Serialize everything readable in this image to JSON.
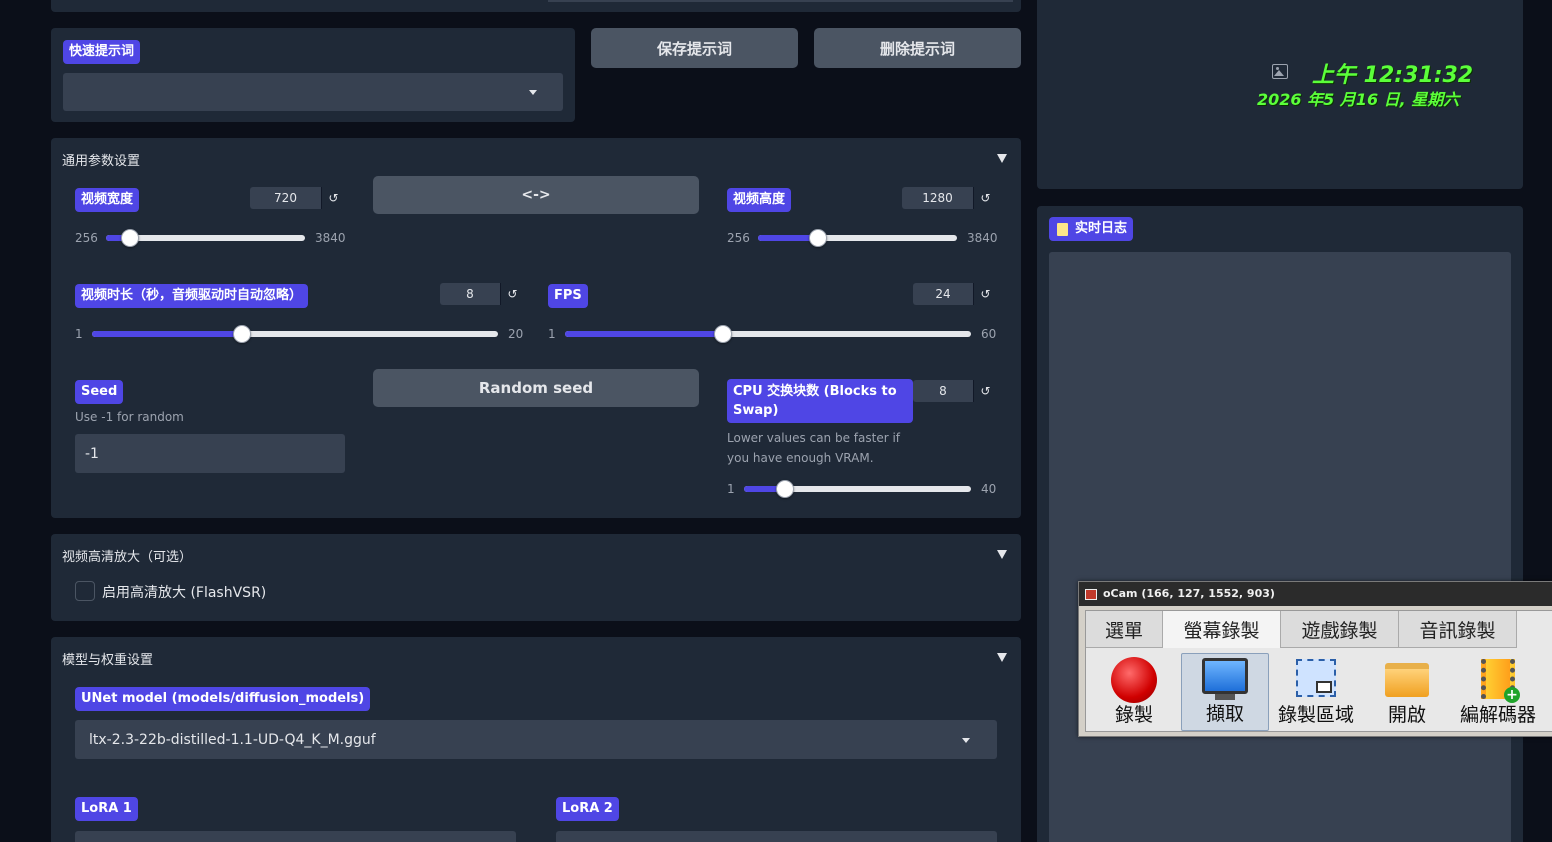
{
  "colors": {
    "accent": "#4f46e5",
    "panel": "#1f2937",
    "bg": "#0b0f19",
    "clock": "#5bff3a"
  },
  "quick_prompt": {
    "label": "快速提示词",
    "value": ""
  },
  "buttons": {
    "save_prompt": "保存提示词",
    "delete_prompt": "删除提示词",
    "swap": "<->",
    "random_seed": "Random seed"
  },
  "general": {
    "title": "通用参数设置",
    "width": {
      "label": "视频宽度",
      "value": "720",
      "min": "256",
      "max": "3840",
      "fraction": 0.12
    },
    "height": {
      "label": "视频高度",
      "value": "1280",
      "min": "256",
      "max": "3840",
      "fraction": 0.3
    },
    "duration": {
      "label": "视频时长（秒，音频驱动时自动忽略）",
      "value": "8",
      "min": "1",
      "max": "20",
      "fraction": 0.37
    },
    "fps": {
      "label": "FPS",
      "value": "24",
      "min": "1",
      "max": "60",
      "fraction": 0.39
    },
    "seed": {
      "label": "Seed",
      "hint": "Use -1 for random",
      "value": "-1"
    },
    "cpu_swap": {
      "label": "CPU 交换块数 (Blocks to Swap)",
      "hint": "Lower values can be faster if you have enough VRAM.",
      "value": "8",
      "min": "1",
      "max": "40",
      "fraction": 0.18
    },
    "reset_symbol": "↺"
  },
  "upscale": {
    "title": "视频高清放大（可选）",
    "checkbox_label": "启用高清放大 (FlashVSR)"
  },
  "model": {
    "title": "模型与权重设置",
    "unet_label": "UNet model (models/diffusion_models)",
    "unet_value": "ltx-2.3-22b-distilled-1.1-UD-Q4_K_M.gguf",
    "lora1_label": "LoRA 1",
    "lora2_label": "LoRA 2"
  },
  "clock": {
    "time": "上午 12:31:32",
    "date": "2026 年5 月16 日, 星期六"
  },
  "log": {
    "label": "实时日志"
  },
  "ocam": {
    "title": "oCam (166, 127, 1552, 903)",
    "tabs": [
      "選單",
      "螢幕錄製",
      "遊戲錄製",
      "音訊錄製"
    ],
    "tools": [
      {
        "label": "錄製",
        "icon": "record-icon"
      },
      {
        "label": "擷取",
        "icon": "monitor-icon"
      },
      {
        "label": "錄製區域",
        "icon": "region-icon"
      },
      {
        "label": "開啟",
        "icon": "folder-icon"
      },
      {
        "label": "編解碼器",
        "icon": "codec-icon"
      }
    ]
  }
}
